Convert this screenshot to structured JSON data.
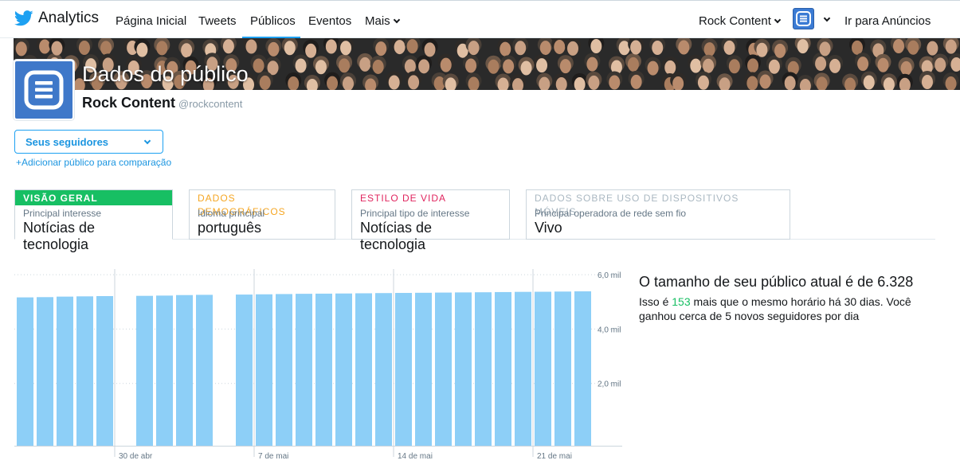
{
  "nav": {
    "brand": "Analytics",
    "items": [
      "Página Inicial",
      "Tweets",
      "Públicos",
      "Eventos",
      "Mais"
    ],
    "active": "Públicos",
    "account": "Rock Content",
    "ads": "Ir para Anúncios"
  },
  "header": {
    "title": "Dados do público",
    "name": "Rock Content",
    "handle": "@rockcontent"
  },
  "audience": {
    "selected": "Seus seguidores",
    "add_compare": "+Adicionar público para comparação"
  },
  "tabs": [
    {
      "head": "VISÃO GERAL",
      "sub": "Principal interesse",
      "value": "Notícias de tecnologia",
      "color": "#17bf63"
    },
    {
      "head": "DADOS DEMOGRÁFICOS",
      "sub": "Idioma principal",
      "value": "português",
      "color": "#f5a623"
    },
    {
      "head": "ESTILO DE VIDA",
      "sub": "Principal tipo de interesse",
      "value": "Notícias de tecnologia",
      "color": "#e0245e"
    },
    {
      "head": "DADOS SOBRE USO DE DISPOSITIVOS MÓVEIS",
      "sub": "Principal operadora de rede sem fio",
      "value": "Vivo",
      "color": "#aab8c2"
    }
  ],
  "summary": {
    "title": "O tamanho de seu público atual é de 6.328",
    "line_prefix": "Isso é ",
    "highlight": "153",
    "line_suffix": " mais que o mesmo horário há 30 dias. Você ganhou cerca de 5 novos seguidores por dia"
  },
  "chart_data": {
    "type": "bar",
    "ytick_labels": [
      "2,0 mil",
      "4,0 mil",
      "6,0 mil"
    ],
    "ytick_values": [
      2000,
      4000,
      6000
    ],
    "ylim": [
      0,
      6500
    ],
    "xtick_labels": [
      "30 de abr",
      "7 de mai",
      "14 de mai",
      "21 de mai"
    ],
    "xtick_after_bar_index": [
      4,
      11,
      18,
      25
    ],
    "values": [
      6210,
      6215,
      6225,
      6230,
      6235,
      null,
      6240,
      6245,
      6255,
      6260,
      null,
      6265,
      6270,
      6275,
      6280,
      6283,
      6286,
      6290,
      6294,
      6297,
      6300,
      6304,
      6307,
      6310,
      6314,
      6318,
      6320,
      6324,
      6328
    ],
    "bar_color": "#8dcff7"
  }
}
